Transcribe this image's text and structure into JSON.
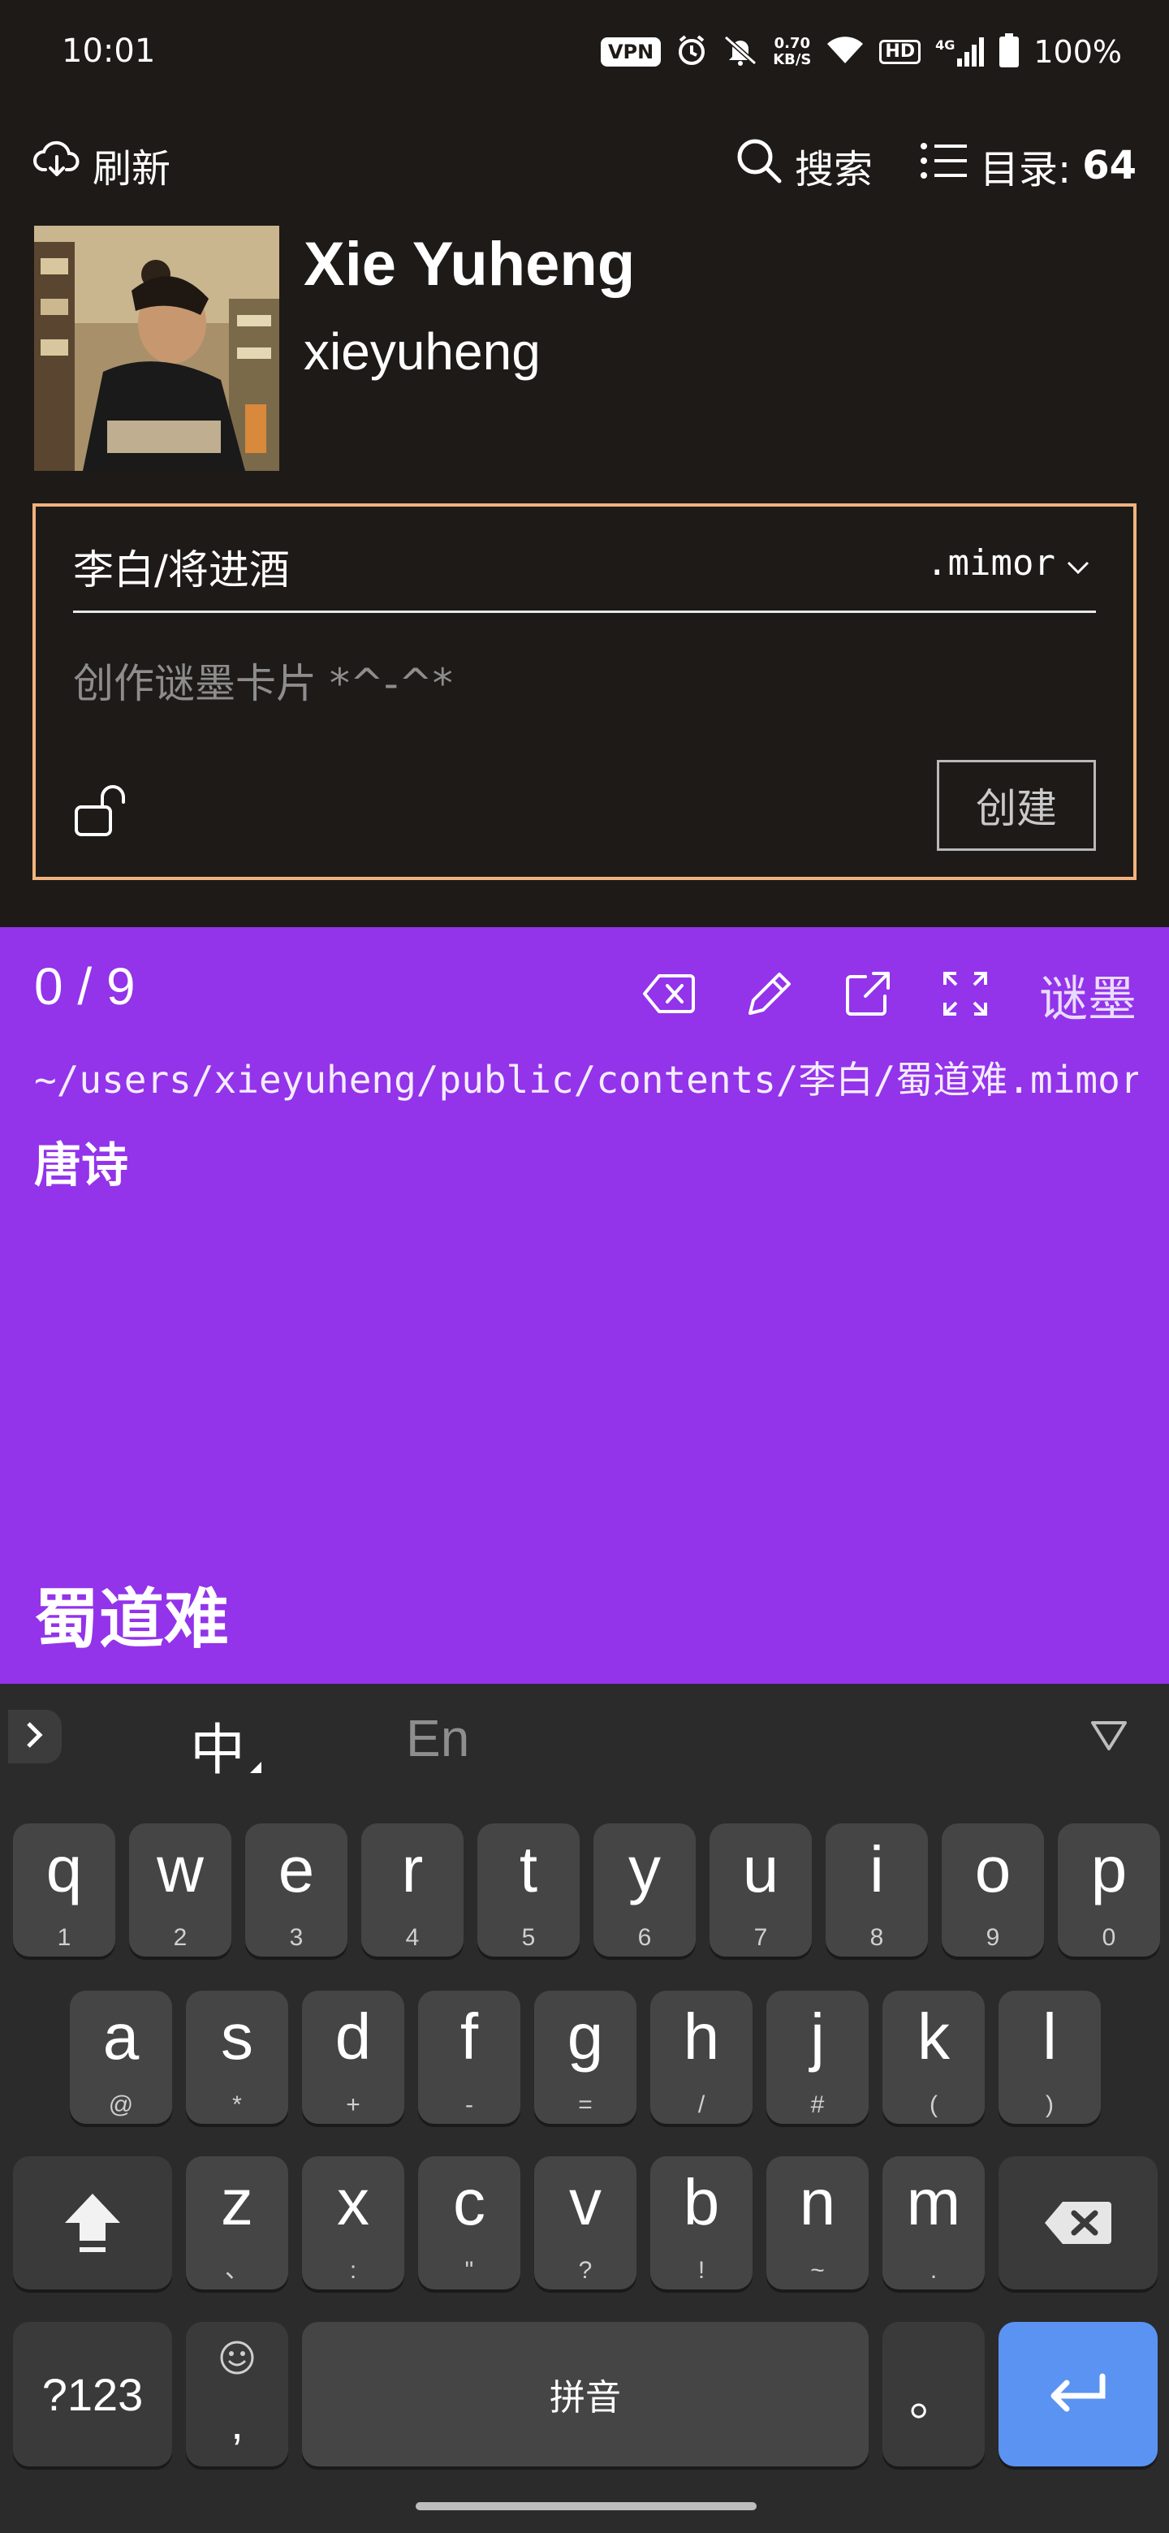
{
  "status_bar": {
    "time": "10:01",
    "vpn": "VPN",
    "net_speed_value": "0.70",
    "net_speed_unit": "KB/S",
    "hd": "HD",
    "signal_type": "4G",
    "battery": "100%"
  },
  "header": {
    "refresh_label": "刷新",
    "search_label": "搜索",
    "toc_label": "目录:",
    "toc_count": "64"
  },
  "profile": {
    "display_name": "Xie Yuheng",
    "username": "xieyuheng"
  },
  "composer": {
    "path_value": "李白/将进酒",
    "extension": ".mimor",
    "placeholder": "创作谜墨卡片 *^-^*",
    "create_label": "创建"
  },
  "card": {
    "counter": "0 / 9",
    "mode_label": "谜墨",
    "file_path": "~/users/xieyuheng/public/contents/李白/蜀道难.mimor",
    "tag": "唐诗",
    "title": "蜀道难",
    "background": "#9333ea"
  },
  "keyboard": {
    "lang_zh": "中",
    "lang_en": "En",
    "row1": [
      {
        "ch": "q",
        "sub": "1"
      },
      {
        "ch": "w",
        "sub": "2"
      },
      {
        "ch": "e",
        "sub": "3"
      },
      {
        "ch": "r",
        "sub": "4"
      },
      {
        "ch": "t",
        "sub": "5"
      },
      {
        "ch": "y",
        "sub": "6"
      },
      {
        "ch": "u",
        "sub": "7"
      },
      {
        "ch": "i",
        "sub": "8"
      },
      {
        "ch": "o",
        "sub": "9"
      },
      {
        "ch": "p",
        "sub": "0"
      }
    ],
    "row2": [
      {
        "ch": "a",
        "sub": "@"
      },
      {
        "ch": "s",
        "sub": "*"
      },
      {
        "ch": "d",
        "sub": "+"
      },
      {
        "ch": "f",
        "sub": "-"
      },
      {
        "ch": "g",
        "sub": "="
      },
      {
        "ch": "h",
        "sub": "/"
      },
      {
        "ch": "j",
        "sub": "#"
      },
      {
        "ch": "k",
        "sub": "("
      },
      {
        "ch": "l",
        "sub": ")"
      }
    ],
    "row3": [
      {
        "ch": "z",
        "sub": "、"
      },
      {
        "ch": "x",
        "sub": ":"
      },
      {
        "ch": "c",
        "sub": "\""
      },
      {
        "ch": "v",
        "sub": "?"
      },
      {
        "ch": "b",
        "sub": "!"
      },
      {
        "ch": "n",
        "sub": "~"
      },
      {
        "ch": "m",
        "sub": "."
      }
    ],
    "symbols_label": "?123",
    "emoji_comma": ",",
    "space_label": "拼音",
    "period_label": "。",
    "accent": "#5b93f2"
  }
}
